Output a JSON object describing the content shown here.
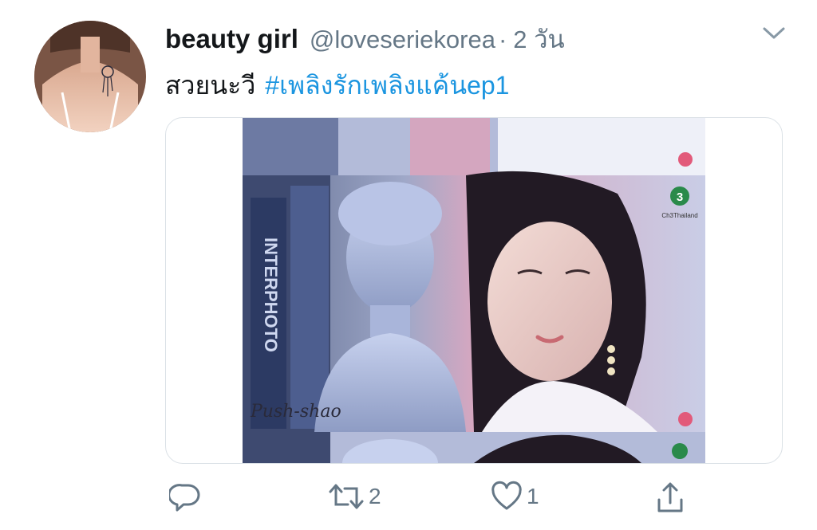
{
  "tweet": {
    "display_name": "beauty girl",
    "handle": "@loveseriekorea",
    "separator": "·",
    "time": "2 วัน",
    "text": "สวยนะวี",
    "hashtag": "#เพลิงรักเพลิงแค้นep1"
  },
  "media": {
    "book_title": "INTERPHOTO",
    "watermark": "Push-shao",
    "channel_logo": "3",
    "channel_caption": "Ch3Thailand"
  },
  "actions": {
    "replies": "",
    "retweets": "2",
    "likes": "1"
  },
  "colors": {
    "link": "#1b95e0",
    "muted": "#657786",
    "text": "#14171a",
    "border": "#dbe1e6"
  },
  "icons": [
    "chevron-down-icon",
    "reply-icon",
    "retweet-icon",
    "like-icon",
    "share-icon"
  ]
}
